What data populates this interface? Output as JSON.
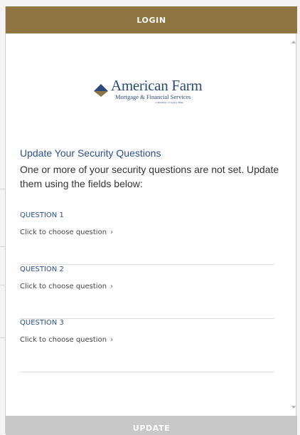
{
  "header": {
    "title": "LOGIN"
  },
  "logo": {
    "name": "American Farm",
    "tagline": "Mortgage & Financial Services",
    "subsidiary": "a subsidiary of Legacy Bank",
    "colors": {
      "text": "#2c4a7c",
      "diamond_top": "#2c4a7c",
      "diamond_bottom": "#8e7541"
    }
  },
  "main": {
    "title": "Update Your Security Questions",
    "description": "One or more of your security questions are not set. Update them using the fields below:",
    "questions": [
      {
        "label": "QUESTION 1",
        "placeholder": "Click to choose question",
        "chevron": "›"
      },
      {
        "label": "QUESTION 2",
        "placeholder": "Click to choose question",
        "chevron": "›"
      },
      {
        "label": "QUESTION 3",
        "placeholder": "Click to choose question",
        "chevron": "›"
      }
    ]
  },
  "footer": {
    "button_label": "UPDATE"
  },
  "colors": {
    "header": "#8e7541",
    "accent": "#2d4f8c",
    "footer_disabled": "#c8c8c8"
  }
}
